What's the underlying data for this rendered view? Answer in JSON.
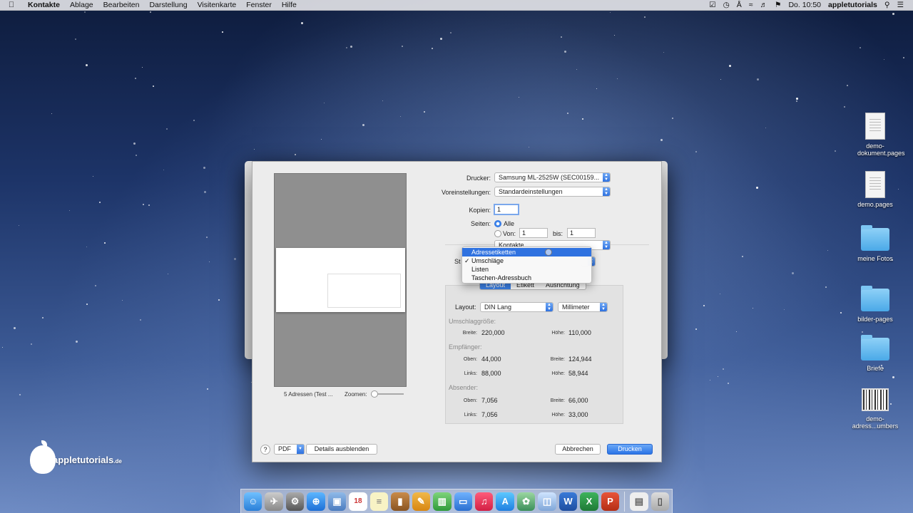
{
  "menubar": {
    "apple": "",
    "items": [
      "Kontakte",
      "Ablage",
      "Bearbeiten",
      "Darstellung",
      "Visitenkarte",
      "Fenster",
      "Hilfe"
    ],
    "time": "Do. 10:50",
    "user": "appletutorials"
  },
  "desktop": {
    "icons": [
      {
        "label": "demo-dokument.pages",
        "icon": "pages-document-icon"
      },
      {
        "label": "demo.pages",
        "icon": "pages-document-icon"
      },
      {
        "label": "meine Fotos",
        "icon": "folder-icon"
      },
      {
        "label": "bilder-pages",
        "icon": "folder-icon"
      },
      {
        "label": "Briefe",
        "icon": "folder-icon"
      },
      {
        "label": "demo-adress...umbers",
        "icon": "numbers-document-icon"
      }
    ]
  },
  "dialog": {
    "printer_label": "Drucker:",
    "printer_value": "Samsung ML-2525W (SEC00159...",
    "presets_label": "Voreinstellungen:",
    "presets_value": "Standardeinstellungen",
    "copies_label": "Kopien:",
    "copies_value": "1",
    "pages_label": "Seiten:",
    "pages_all": "Alle",
    "pages_from": "Von:",
    "from_value": "1",
    "pages_to": "bis:",
    "to_value": "1",
    "app_popup": "Kontakte",
    "style_label_partial": "St",
    "tabs": [
      "Layout",
      "Etikett",
      "Ausrichtung"
    ],
    "layout_label": "Layout:",
    "layout_value": "DIN Lang",
    "unit_value": "Millimeter",
    "envelope_size_title": "Umschlaggröße:",
    "width_label": "Breite:",
    "height_label": "Höhe:",
    "envelope_width": "220,000",
    "envelope_height": "110,000",
    "recipient_title": "Empfänger:",
    "top_label": "Oben:",
    "left_label": "Links:",
    "recipient_top": "44,000",
    "recipient_width": "124,944",
    "recipient_left": "88,000",
    "recipient_height": "58,944",
    "sender_title": "Absender:",
    "sender_top": "7,056",
    "sender_width": "66,000",
    "sender_left": "7,056",
    "sender_height": "33,000",
    "preview_info": "5 Adressen (Test ...",
    "zoom_label": "Zoomen:",
    "zoom_level": 0,
    "help": "?",
    "pdf": "PDF",
    "hide_details": "Details ausblenden",
    "cancel": "Abbrechen",
    "print": "Drucken"
  },
  "style_menu": {
    "items": [
      {
        "label": "Adressetiketten",
        "highlighted": true,
        "checked": false
      },
      {
        "label": "Umschläge",
        "highlighted": false,
        "checked": true
      },
      {
        "label": "Listen",
        "highlighted": false,
        "checked": false
      },
      {
        "label": "Taschen-Adressbuch",
        "highlighted": false,
        "checked": false
      }
    ],
    "check": "✓"
  },
  "logo": {
    "name": "appletutorials",
    "tld": ".de"
  },
  "colors": {
    "accent": "#2f72e0"
  }
}
